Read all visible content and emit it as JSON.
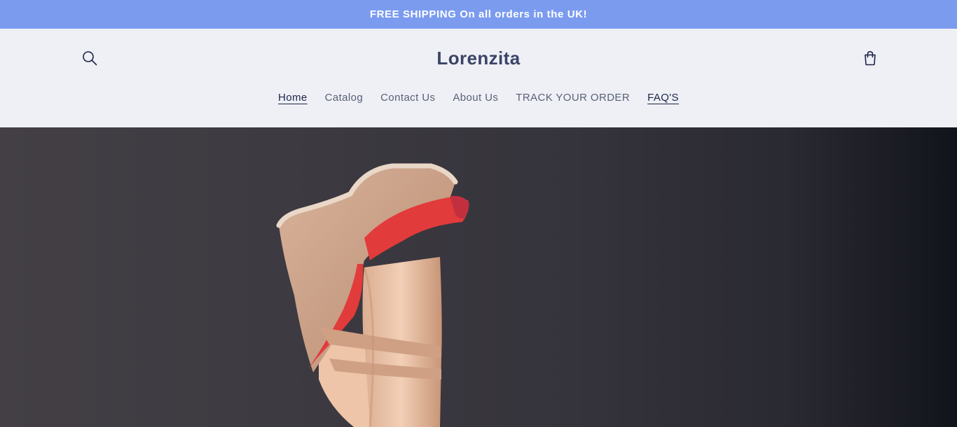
{
  "announcement": {
    "text": "FREE SHIPPING On all orders in the UK!"
  },
  "header": {
    "logo": "Lorenzita",
    "search_icon": "search-icon",
    "cart_icon": "cart-icon"
  },
  "nav": {
    "items": [
      {
        "label": "Home"
      },
      {
        "label": "Catalog"
      },
      {
        "label": "Contact Us"
      },
      {
        "label": "About Us"
      },
      {
        "label": "TRACK YOUR ORDER"
      },
      {
        "label": "FAQ'S"
      }
    ]
  },
  "colors": {
    "announcement_bg": "#7b9bef",
    "header_bg": "#eef0f6",
    "logo_text": "#3c4466",
    "hero_bg": "#3d3a41",
    "shoe_strap": "#e23b3b"
  }
}
